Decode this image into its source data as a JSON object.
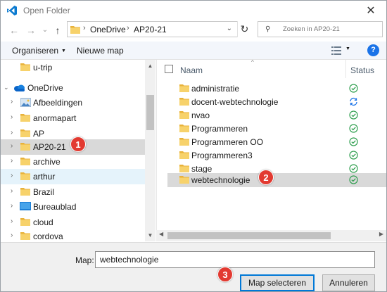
{
  "window": {
    "title": "Open Folder"
  },
  "address": {
    "crumbs": [
      "OneDrive",
      "AP20-21"
    ],
    "search_placeholder": "Zoeken in AP20-21"
  },
  "toolbar": {
    "organize": "Organiseren",
    "new_folder": "Nieuwe map"
  },
  "nav": {
    "items": [
      {
        "label": "u-trip",
        "icon": "folder-icon",
        "expand": ""
      },
      {
        "label": "OneDrive",
        "icon": "onedrive-cloud-icon",
        "expand": "v"
      },
      {
        "label": "Afbeeldingen",
        "icon": "pictures-folder-icon",
        "expand": ">"
      },
      {
        "label": "anormapart",
        "icon": "folder-icon",
        "expand": ">"
      },
      {
        "label": "AP",
        "icon": "folder-icon",
        "expand": ">"
      },
      {
        "label": "AP20-21",
        "icon": "folder-icon",
        "expand": ">",
        "selected": true
      },
      {
        "label": "archive",
        "icon": "folder-icon",
        "expand": ">"
      },
      {
        "label": "arthur",
        "icon": "folder-icon",
        "expand": ">",
        "hover": true
      },
      {
        "label": "Brazil",
        "icon": "folder-icon",
        "expand": ">"
      },
      {
        "label": "Bureaublad",
        "icon": "desktop-icon",
        "expand": ">"
      },
      {
        "label": "cloud",
        "icon": "folder-icon",
        "expand": ">"
      },
      {
        "label": "cordova",
        "icon": "folder-icon",
        "expand": ">"
      }
    ]
  },
  "files": {
    "columns": {
      "name": "Naam",
      "status": "Status"
    },
    "rows": [
      {
        "name": "administratie",
        "status": "synced"
      },
      {
        "name": "docent-webtechnologie",
        "status": "syncing"
      },
      {
        "name": "nvao",
        "status": "synced"
      },
      {
        "name": "Programmeren",
        "status": "synced"
      },
      {
        "name": "Programmeren OO",
        "status": "synced"
      },
      {
        "name": "Programmeren3",
        "status": "synced"
      },
      {
        "name": "stage",
        "status": "synced"
      },
      {
        "name": "webtechnologie",
        "status": "synced",
        "selected": true
      }
    ]
  },
  "bottom": {
    "map_label": "Map:",
    "map_value": "webtechnologie",
    "select_button": "Map selecteren",
    "cancel_button": "Annuleren"
  },
  "badges": [
    "1",
    "2",
    "3"
  ],
  "colors": {
    "accent": "#0078d7",
    "badge": "#e23a31",
    "folder": "#f5c842",
    "sync_ok": "#2e9e4e",
    "sync_busy": "#1a73e8",
    "selection": "#d9d9d9"
  }
}
